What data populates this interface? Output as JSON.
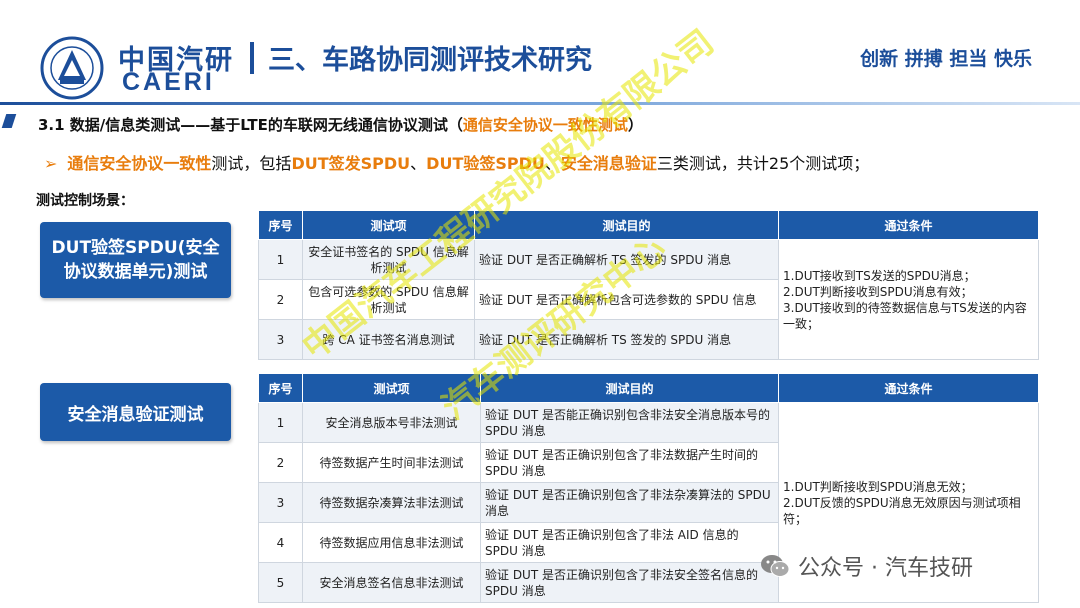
{
  "header": {
    "logo_cn": "中国汽研",
    "logo_en": "CAERI",
    "title": "三、车路协同测评技术研究",
    "slogan": "创新 拼搏 担当 快乐"
  },
  "section": {
    "title_prefix": "3.1 数据/信息类测试——基于LTE的车联网无线通信协议测试（",
    "title_highlight": "通信安全协议一致性测试",
    "title_suffix": "）"
  },
  "subline": {
    "p1": "通信安全协议一致性",
    "p2": "测试，包括",
    "p3": "DUT签发SPDU",
    "p4": "、",
    "p5": "DUT验签SPDU",
    "p6": "、",
    "p7": "安全消息验证",
    "p8": "三类测试，共计25个测试项；"
  },
  "scene_label": "测试控制场景：",
  "box1": "DUT验签SPDU(安全协议数据单元)测试",
  "box2": "安全消息验证测试",
  "table1": {
    "headers": [
      "序号",
      "测试项",
      "测试目的",
      "通过条件"
    ],
    "rows": [
      {
        "idx": "1",
        "item": "安全证书签名的 SPDU 信息解析测试",
        "purpose": "验证 DUT 是否正确解析 TS 签发的 SPDU 消息"
      },
      {
        "idx": "2",
        "item": "包含可选参数的 SPDU 信息解析测试",
        "purpose": "验证 DUT 是否正确解析包含可选参数的 SPDU 信息"
      },
      {
        "idx": "3",
        "item": "跨 CA 证书签名消息测试",
        "purpose": "验证 DUT 是否正确解析 TS 签发的 SPDU 消息"
      }
    ],
    "pass": "1.DUT接收到TS发送的SPDU消息；\n2.DUT判断接收到SPDU消息有效；\n3.DUT接收到的待签数据信息与TS发送的内容一致；"
  },
  "table2": {
    "headers": [
      "序号",
      "测试项",
      "测试目的",
      "通过条件"
    ],
    "rows": [
      {
        "idx": "1",
        "item": "安全消息版本号非法测试",
        "purpose": "验证 DUT 是否能正确识别包含非法安全消息版本号的 SPDU 消息"
      },
      {
        "idx": "2",
        "item": "待签数据产生时间非法测试",
        "purpose": "验证 DUT 是否正确识别包含了非法数据产生时间的 SPDU 消息"
      },
      {
        "idx": "3",
        "item": "待签数据杂凑算法非法测试",
        "purpose": "验证 DUT 是否正确识别包含了非法杂凑算法的 SPDU 消息"
      },
      {
        "idx": "4",
        "item": "待签数据应用信息非法测试",
        "purpose": "验证 DUT 是否正确识别包含了非法 AID 信息的 SPDU 消息"
      },
      {
        "idx": "5",
        "item": "安全消息签名信息非法测试",
        "purpose": "验证 DUT 是否正确识别包含了非法安全签名信息的 SPDU 消息"
      }
    ],
    "pass": "1.DUT判断接收到SPDU消息无效；\n2.DUT反馈的SPDU消息无效原因与测试项相符；"
  },
  "watermark": {
    "line1": "中国汽车工程研究院股份有限公司",
    "line2": "汽车测评研究中心"
  },
  "wechat": "公众号 · 汽车技研"
}
